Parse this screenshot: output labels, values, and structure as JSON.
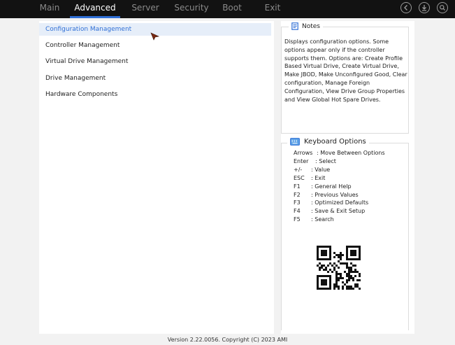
{
  "tabs": [
    "Main",
    "Advanced",
    "Server",
    "Security",
    "Boot",
    "Exit"
  ],
  "active_tab": "Advanced",
  "top_icons": [
    "back-icon",
    "download-icon",
    "search-icon"
  ],
  "menu": [
    "Configuration Management",
    "Controller Management",
    "Virtual Drive Management",
    "Drive Management",
    "Hardware Components"
  ],
  "notes": {
    "title": "Notes",
    "text": "Displays configuration options. Some options appear only if the controller supports them. Options are: Create Profile Based Virtual Drive, Create Virtual Drive, Make JBOD, Make Unconfigured Good, Clear configuration, Manage Foreign Configuration, View Drive Group Properties and View Global Hot Spare Drives."
  },
  "keyboard": {
    "title": "Keyboard Options",
    "rows": [
      {
        "key": "Arrows",
        "desc": ": Move Between Options"
      },
      {
        "key": "Enter",
        "desc": ": Select"
      },
      {
        "key": "+/-",
        "desc": ": Value"
      },
      {
        "key": "ESC",
        "desc": ": Exit"
      },
      {
        "key": "F1",
        "desc": ": General Help"
      },
      {
        "key": "F2",
        "desc": ": Previous Values"
      },
      {
        "key": "F3",
        "desc": ": Optimized Defaults"
      },
      {
        "key": "F4",
        "desc": ": Save & Exit Setup"
      },
      {
        "key": "F5",
        "desc": ": Search"
      }
    ]
  },
  "footer": "Version 2.22.0056. Copyright (C) 2023 AMI",
  "colors": {
    "accent": "#2f6fd6",
    "topbar": "#121212",
    "selected_bg": "#e6eef9"
  }
}
